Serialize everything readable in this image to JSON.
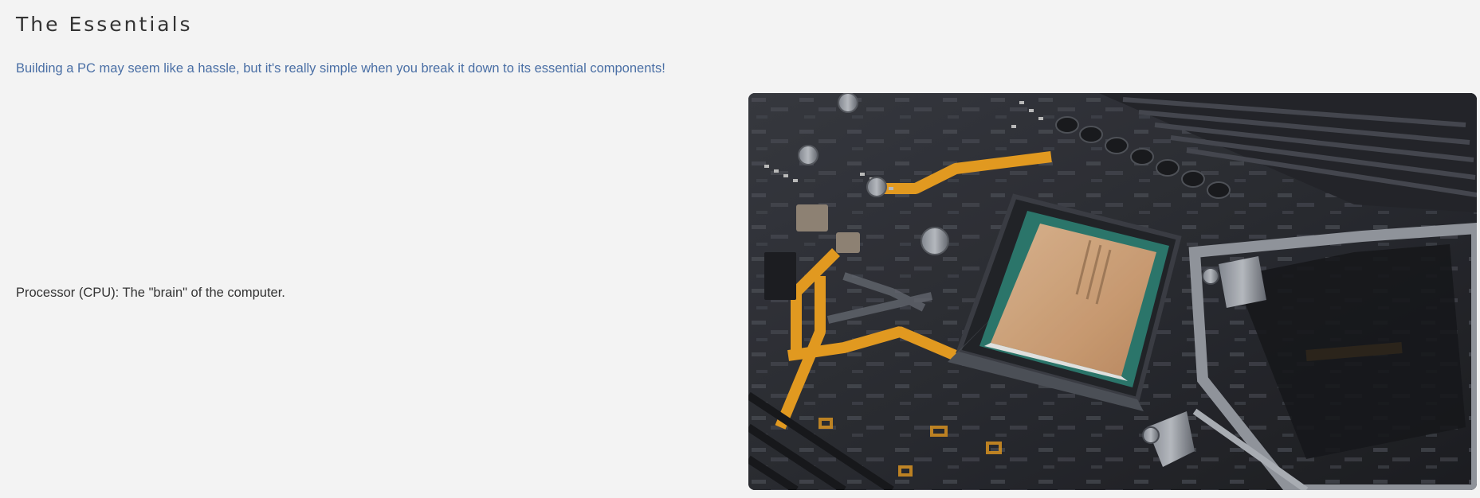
{
  "section": {
    "title": "The Essentials",
    "intro": "Building a PC may seem like a hassle, but it's really simple when you break it down to its essential components!"
  },
  "components": [
    {
      "label": "Processor (CPU): The \"brain\" of the computer.",
      "image_icon": "cpu-motherboard-photo"
    }
  ],
  "colors": {
    "background": "#f3f3f3",
    "title": "#333333",
    "intro": "#4a6fa5",
    "body_text": "#333333",
    "board_accent": "#f5a623"
  }
}
